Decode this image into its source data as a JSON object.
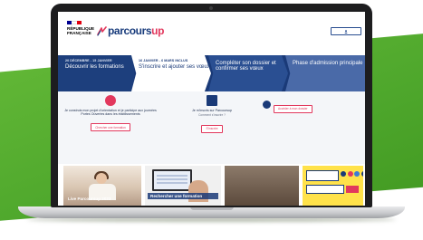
{
  "brand": {
    "republic": [
      "RÉPUBLIQUE",
      "FRANÇAISE"
    ],
    "logo_part1": "parcours",
    "logo_part2": "up",
    "colors": {
      "navy": "#1a3a78",
      "pink": "#e2385d",
      "green": "#4ea72c"
    }
  },
  "nav": {
    "items": [],
    "connect_label": ""
  },
  "timeline": {
    "stages": [
      {
        "dates": "20 DÉCEMBRE - 15 JANVIER",
        "title": "Découvrir les formations"
      },
      {
        "dates": "16 JANVIER - 6 MARS INCLUS",
        "title": "S'inscrire et ajouter ses vœux"
      },
      {
        "dates": "",
        "title": "Compléter son dossier et confirmer ses vœux"
      },
      {
        "dates": "",
        "title": "Phase d'admission principale"
      }
    ]
  },
  "columns": {
    "c1": {
      "text": "Je construis mon projet d'orientation et je participe aux journées Portes Ouvertes dans les établissements",
      "button": "Chercher une formation"
    },
    "c2": {
      "text": "Je m'inscris sur Parcoursup",
      "link": "Comment s'inscrire ?",
      "button": "S'inscrire"
    },
    "c3": {
      "text": "",
      "items": [],
      "button": "Accéder à mon dossier"
    }
  },
  "media": {
    "tile1_caption": "Live Parcoursup 2023",
    "tile2_caption": "Rechercher une formation",
    "tile4_box1": "",
    "tile4_box2": ""
  },
  "icons": [
    "marianne-logo",
    "parcoursup-logo",
    "user-icon",
    "pen-icon",
    "monitor-icon",
    "folder-icon",
    "play-icon"
  ]
}
